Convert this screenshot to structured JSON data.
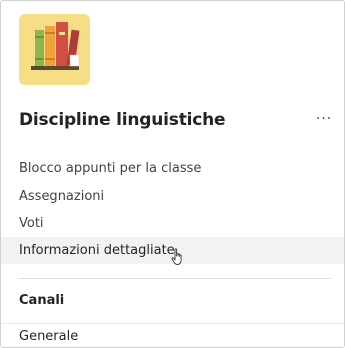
{
  "team": {
    "name": "Discipline linguistiche",
    "avatar_icon": "books-on-shelf-icon",
    "more_icon": "more-options-icon",
    "more_label": "···"
  },
  "nav": {
    "items": [
      {
        "label": "Blocco appunti per la classe"
      },
      {
        "label": "Assegnazioni"
      },
      {
        "label": "Voti"
      },
      {
        "label": "Informazioni dettagliate",
        "hovered": true
      }
    ]
  },
  "channels": {
    "heading": "Canali",
    "items": [
      {
        "label": "Generale"
      }
    ]
  },
  "colors": {
    "avatar_bg": "#f6de86",
    "hover_bg": "#f3f2f1",
    "book_green": "#8fb54d",
    "book_orange": "#f0a23b",
    "book_red": "#d24f45",
    "book_dark_red": "#b23a3b",
    "shelf": "#5a4a2e"
  }
}
